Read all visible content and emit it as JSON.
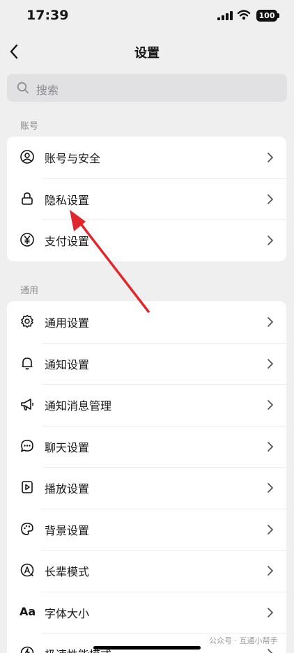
{
  "status_bar": {
    "time": "17:39",
    "battery": "100"
  },
  "nav": {
    "title": "设置"
  },
  "search": {
    "placeholder": "搜索"
  },
  "sections": [
    {
      "title": "账号",
      "items": [
        {
          "label": "账号与安全",
          "icon": "user-circle-icon"
        },
        {
          "label": "隐私设置",
          "icon": "lock-icon"
        },
        {
          "label": "支付设置",
          "icon": "yen-icon"
        }
      ]
    },
    {
      "title": "通用",
      "items": [
        {
          "label": "通用设置",
          "icon": "gear-icon"
        },
        {
          "label": "通知设置",
          "icon": "bell-icon"
        },
        {
          "label": "通知消息管理",
          "icon": "megaphone-icon"
        },
        {
          "label": "聊天设置",
          "icon": "chat-bubble-icon"
        },
        {
          "label": "播放设置",
          "icon": "play-icon"
        },
        {
          "label": "背景设置",
          "icon": "palette-icon"
        },
        {
          "label": "长辈模式",
          "icon": "elder-mode-icon"
        },
        {
          "label": "字体大小",
          "icon": "font-size-icon",
          "icon_text": "Aa"
        },
        {
          "label": "极速性能模式",
          "icon": "performance-icon"
        }
      ]
    }
  ],
  "watermark": "公众号 · 互通小帮手",
  "colors": {
    "background": "#efeff0",
    "card": "#ffffff",
    "arrow": "#e0282c",
    "secondary_text": "#8b8b8f"
  }
}
